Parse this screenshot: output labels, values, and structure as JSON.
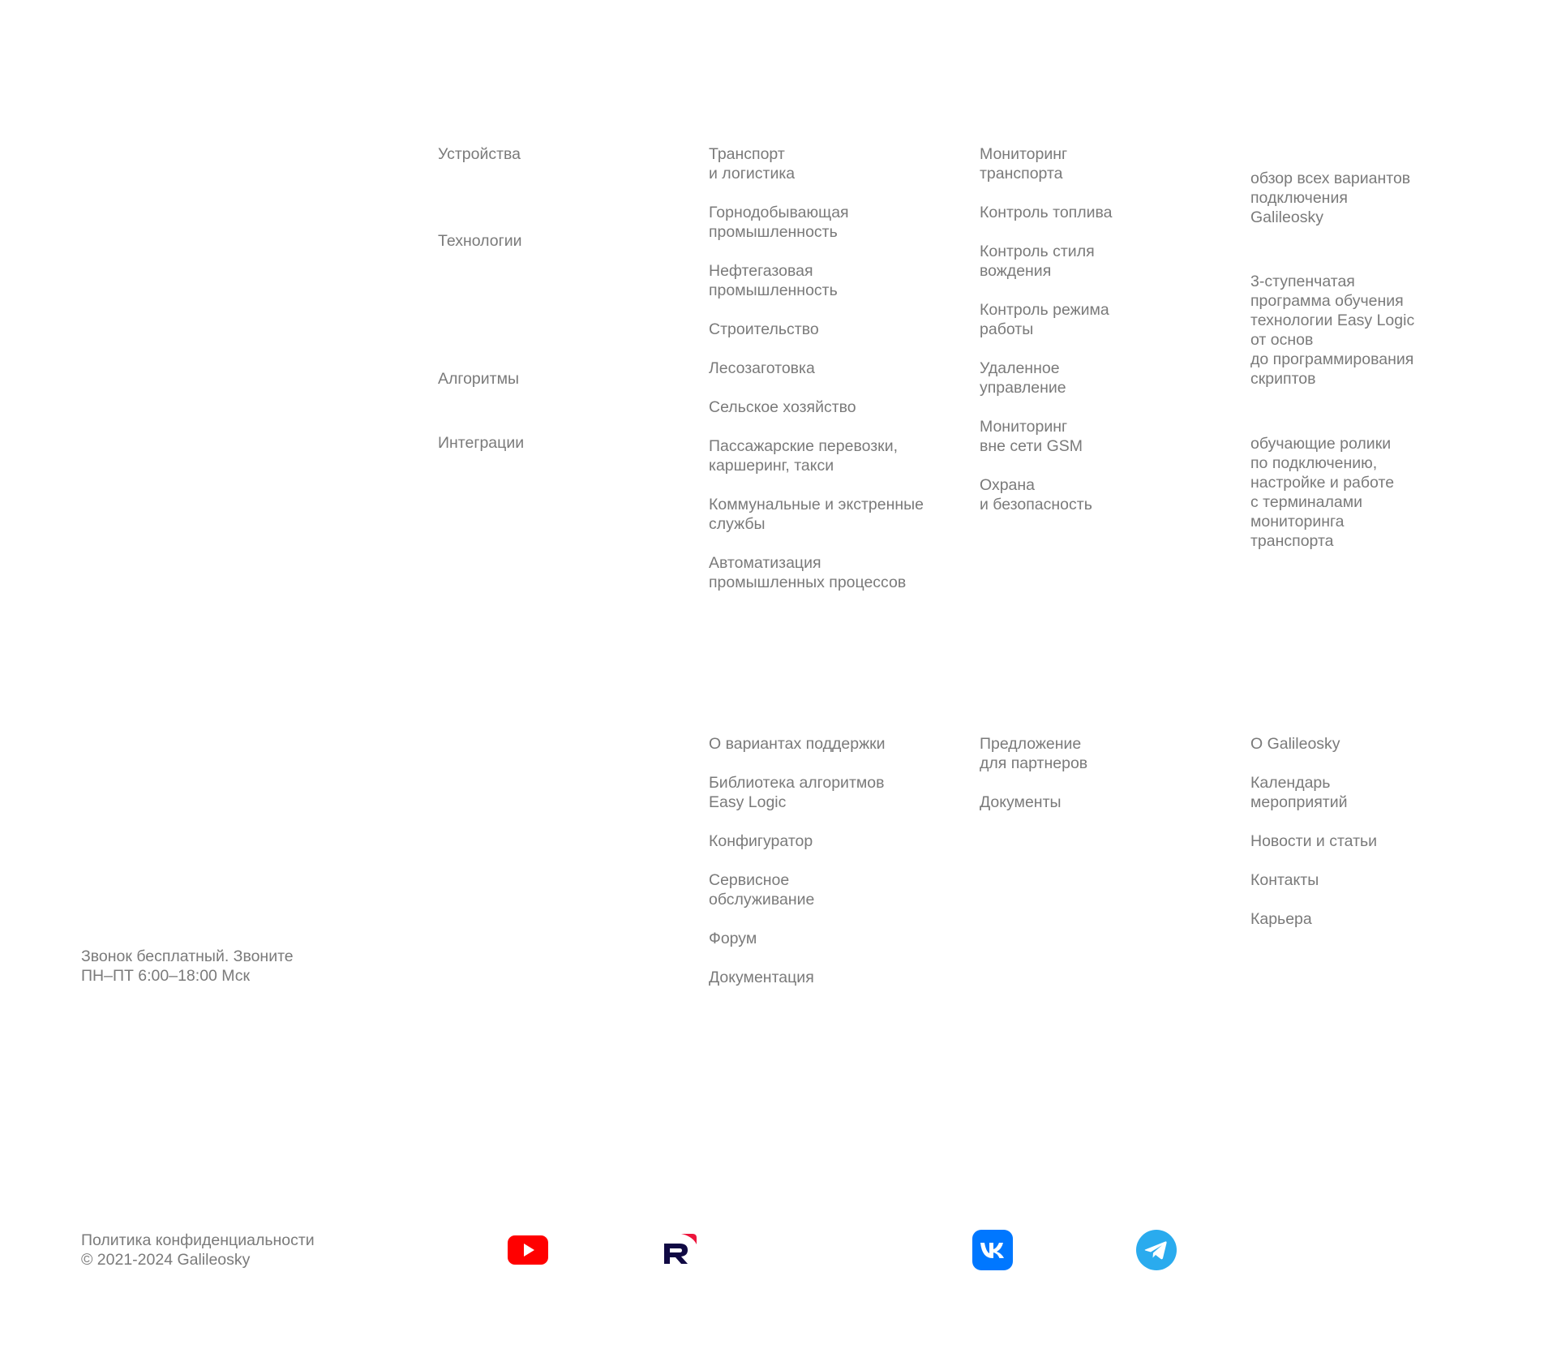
{
  "categories": {
    "devices": "Устройства",
    "technologies": "Технологии",
    "algorithms": "Алгоритмы",
    "integrations": "Интеграции"
  },
  "industries": [
    "Транспорт\nи логистика",
    "Горнодобывающая\nпромышленность",
    "Нефтегазовая\nпромышленность",
    "Строительство",
    "Лесозаготовка",
    "Сельское хозяйство",
    "Пассажарские перевозки,\nкаршеринг, такси",
    "Коммунальные и экстренные\nслужбы",
    "Автоматизация\nпромышленных процессов"
  ],
  "solutions": [
    "Мониторинг\nтранспорта",
    "Контроль топлива",
    "Контроль стиля\nвождения",
    "Контроль режима\nработы",
    "Удаленное\nуправление",
    "Мониторинг\nвне сети GSM",
    "Охрана\nи безопасность"
  ],
  "promos": {
    "integrations": "обзор всех вариантов\nподключения\nGalileosky",
    "education": "3-ступенчатая\nпрограмма  обучения\nтехнологии Easy Logic\nот основ\nдо программирования\nскриптов",
    "videos": "обучающие ролики\nпо подключению,\nнастройке и работе\nс терминалами\nмониторинга\nтранспорта"
  },
  "support": [
    "О вариантах поддержки",
    "Библиотека алгоритмов\nEasy Logic",
    "Конфигуратор",
    "Сервисное\nобслуживание",
    "Форум",
    "Документация"
  ],
  "partners": [
    "Предложение\nдля партнеров",
    "Документы"
  ],
  "company": [
    "О Galileosky",
    "Календарь\nмероприятий",
    "Новости и статьи",
    "Контакты",
    "Карьера"
  ],
  "call_note": "Звонок бесплатный. Звоните\nПН–ПТ 6:00–18:00 Мск",
  "legal": {
    "privacy": "Политика конфиденциальности",
    "copyright": "© 2021-2024 Galileosky"
  },
  "social": {
    "youtube": {
      "icon": "youtube-icon",
      "color": "#FF0000"
    },
    "rutube": {
      "icon": "rutube-icon",
      "color": "#100943",
      "accent": "#ED143B"
    },
    "vk": {
      "icon": "vk-icon",
      "color": "#0077FF"
    },
    "telegram": {
      "icon": "telegram-icon",
      "color": "#2AABEE"
    }
  }
}
